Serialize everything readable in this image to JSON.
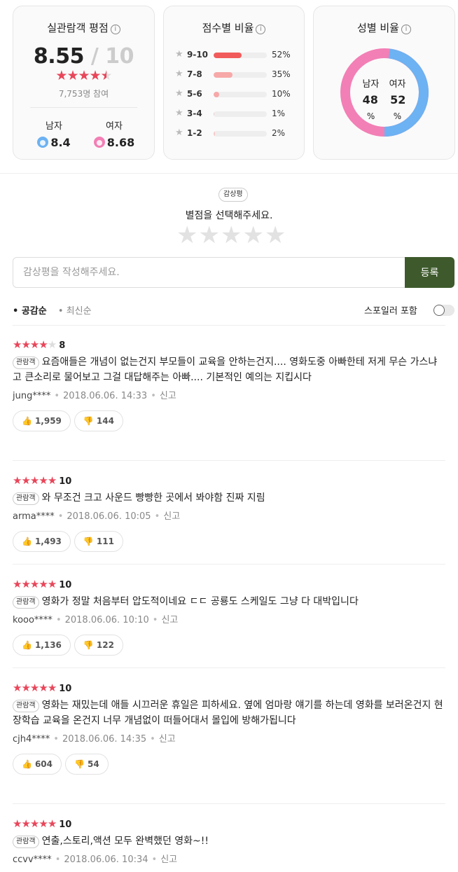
{
  "audience_rating": {
    "title": "실관람객 평점",
    "score": "8.55",
    "max": "/ 10",
    "stars_filled": 4.5,
    "participants": "7,753명 참여",
    "male_label": "남자",
    "male_score": "8.4",
    "female_label": "여자",
    "female_score": "8.68"
  },
  "distribution": {
    "title": "점수별 비율",
    "rows": [
      {
        "label": "9-10",
        "pct": "52%",
        "value": 52,
        "color": "#f15b5b"
      },
      {
        "label": "7-8",
        "pct": "35%",
        "value": 35,
        "color": "#f7a8a8"
      },
      {
        "label": "5-6",
        "pct": "10%",
        "value": 10,
        "color": "#f7a8a8"
      },
      {
        "label": "3-4",
        "pct": "1%",
        "value": 1,
        "color": "#f7c8c8"
      },
      {
        "label": "1-2",
        "pct": "2%",
        "value": 2,
        "color": "#f7c8c8"
      }
    ]
  },
  "gender": {
    "title": "성별 비율",
    "male_label": "남자",
    "female_label": "여자",
    "male_value": "48",
    "female_value": "52",
    "unit": "%",
    "male_fraction": 0.48,
    "male_color": "#6db2f2",
    "female_color": "#f27fb5"
  },
  "write": {
    "badge": "감상평",
    "prompt": "별점을 선택해주세요.",
    "stars": "★★★★★",
    "placeholder": "감상평을 작성해주세요.",
    "submit": "등록"
  },
  "sort": {
    "active": "• 공감순",
    "inactive": "• 최신순",
    "spoiler_label": "스포일러 포함"
  },
  "reviews": [
    {
      "stars": 4,
      "score": "8",
      "badge": "관람객",
      "text": "요즘애들은 개념이 없는건지 부모들이 교육을 안하는건지.... 영화도중 아빠한테 저게 무슨 가스냐고 큰소리로 물어보고 그걸 대답해주는 아빠.... 기본적인 예의는 지킵시다",
      "user": "jung****",
      "date": "2018.06.06. 14:33",
      "report": "신고",
      "likes": "1,959",
      "dislikes": "144"
    },
    {
      "stars": 5,
      "score": "10",
      "badge": "관람객",
      "text": "와 무조건 크고 사운드 빵빵한 곳에서 봐야함 진짜 지림",
      "user": "arma****",
      "date": "2018.06.06. 10:05",
      "report": "신고",
      "likes": "1,493",
      "dislikes": "111"
    },
    {
      "stars": 5,
      "score": "10",
      "badge": "관람객",
      "text": "영화가 정말 처음부터 압도적이네요 ㄷㄷ 공룡도 스케일도 그냥 다 대박입니다",
      "user": "kooo****",
      "date": "2018.06.06. 10:10",
      "report": "신고",
      "likes": "1,136",
      "dislikes": "122"
    },
    {
      "stars": 5,
      "score": "10",
      "badge": "관람객",
      "text": "영화는 재밌는데 애들 시끄러운 휴일은 피하세요. 옆에 엄마랑 얘기를 하는데 영화를 보러온건지 현장학습 교육을 온건지 너무 개념없이 떠들어대서 몰입에 방해가됩니다",
      "user": "cjh4****",
      "date": "2018.06.06. 14:35",
      "report": "신고",
      "likes": "604",
      "dislikes": "54"
    },
    {
      "stars": 5,
      "score": "10",
      "badge": "관람객",
      "text": "연출,스토리,액션 모두 완벽했던 영화~!!",
      "user": "ccvv****",
      "date": "2018.06.06. 10:34",
      "report": "신고",
      "likes": "",
      "dislikes": ""
    }
  ]
}
